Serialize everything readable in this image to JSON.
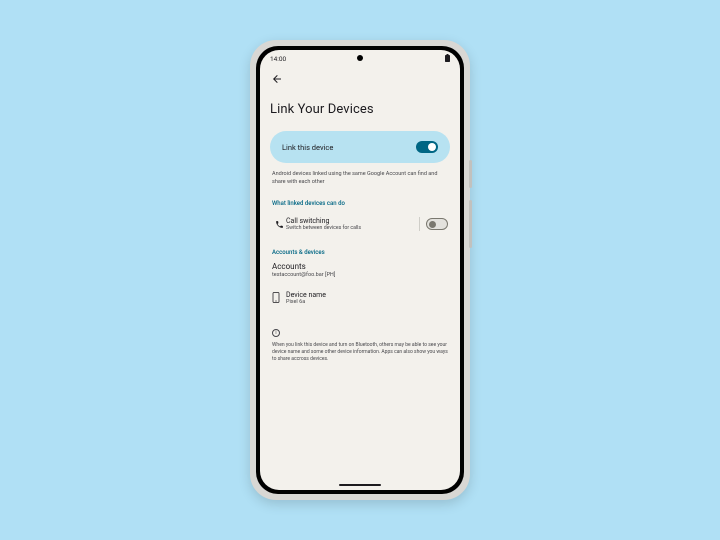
{
  "status": {
    "time": "14:00"
  },
  "page": {
    "title": "Link Your Devices"
  },
  "main_toggle": {
    "label": "Link this device"
  },
  "description": "Android devices linked using the same Google Account can find and share with each other",
  "sections": {
    "capabilities_header": "What linked devices can do",
    "accounts_header": "Accounts & devices"
  },
  "call_switching": {
    "title": "Call switching",
    "subtitle": "Switch between devices for calls"
  },
  "accounts": {
    "title": "Accounts",
    "value": "testaccount@foo.bar [PH]"
  },
  "device": {
    "title": "Device name",
    "value": "Pixel 6a"
  },
  "info": "When you link this device and turn on Bluetooth, others may be able to see your device name and some other device information. Apps can also show you ways to share accross devices."
}
